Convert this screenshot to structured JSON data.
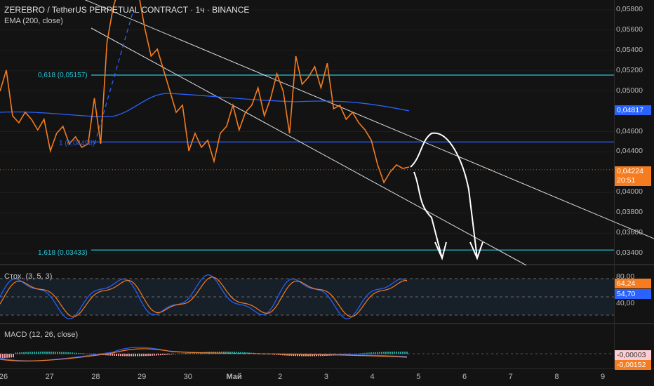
{
  "header": {
    "title": "ZEREBRO / TetherUS PERPETUAL CONTRACT · 1ч · BINANCE",
    "ema": "EMA (200, close)"
  },
  "price_axis": [
    "0,05800",
    "0,05600",
    "0,05400",
    "0,05200",
    "0,05000",
    "0,04600",
    "0,04400",
    "0,04000",
    "0,03800",
    "0,03600",
    "0,03400"
  ],
  "price_axis_values": [
    0.058,
    0.056,
    0.054,
    0.052,
    0.05,
    0.046,
    0.044,
    0.04,
    0.038,
    0.036,
    0.034
  ],
  "ema_tag": "0,04817",
  "last_price": "0,04224",
  "countdown": "20:51",
  "fib": [
    {
      "label": "0,618 (0,05157)",
      "price": 0.05157,
      "color": "#26c6da"
    },
    {
      "label": "1 (0,04498)",
      "price": 0.04498,
      "color": "#2962ff"
    },
    {
      "label": "1,618 (0,03433)",
      "price": 0.03433,
      "color": "#26c6da"
    }
  ],
  "stoch": {
    "title": "Стох. (3, 5, 3)",
    "upper": "80,00",
    "lower": "40,00",
    "k": "64,24",
    "d": "54,70"
  },
  "macd": {
    "title": "MACD (12, 26, close)",
    "v1": "-0,00003",
    "v2": "-0,00152"
  },
  "x_axis": [
    "26",
    "27",
    "28",
    "29",
    "30",
    "Май",
    "2",
    "3",
    "4",
    "5",
    "6",
    "7",
    "8",
    "9"
  ],
  "colors": {
    "price": "#f57c1f",
    "ema": "#2962ff",
    "bg": "#131313"
  },
  "chart_data": {
    "type": "line",
    "series": [
      {
        "name": "price",
        "values": [
          0.04998,
          0.05205,
          0.04756,
          0.04687,
          0.0479,
          0.04721,
          0.04617,
          0.04721,
          0.0441,
          0.04583,
          0.04652,
          0.04479,
          0.04548,
          0.04445,
          0.04479,
          0.04929,
          0.04479,
          0.05482,
          0.05828,
          0.06035,
          0.06035,
          0.06035,
          0.05966,
          0.0562,
          0.05344,
          0.05413,
          0.05205,
          0.04998,
          0.0479,
          0.0486,
          0.0441,
          0.04583,
          0.04445,
          0.04514,
          0.04306,
          0.04583,
          0.04652,
          0.0486,
          0.04617,
          0.0479,
          0.0486,
          0.05032,
          0.04756,
          0.0493,
          0.05171,
          0.04998,
          0.04583,
          0.05344,
          0.05066,
          0.05136,
          0.0524,
          0.05032,
          0.05274,
          0.04825,
          0.0486,
          0.04721,
          0.0479,
          0.04687,
          0.04617,
          0.04514,
          0.04272,
          0.04099,
          0.04203,
          0.04272,
          0.04237,
          0.04251
        ]
      }
    ]
  }
}
